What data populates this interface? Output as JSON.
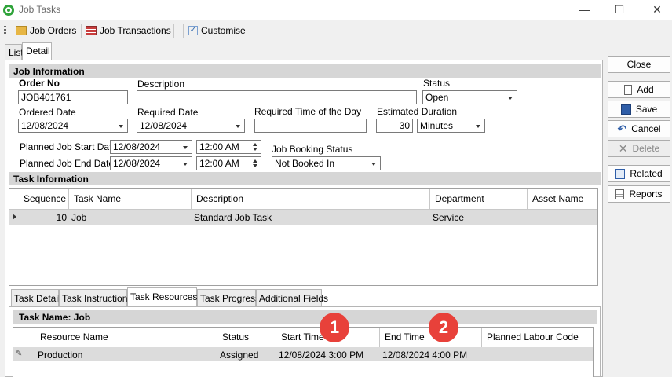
{
  "window": {
    "title": "Job Tasks",
    "minimize": "—",
    "maximize": "☐",
    "close": "✕"
  },
  "toolbar": {
    "job_orders": "Job Orders",
    "job_transactions": "Job Transactions",
    "customise": "Customise"
  },
  "tabs": {
    "list": "List",
    "detail": "Detail"
  },
  "job_info": {
    "header": "Job Information",
    "order_no_label": "Order No",
    "order_no": "JOB401761",
    "description_label": "Description",
    "description": "",
    "status_label": "Status",
    "status": "Open",
    "ordered_date_label": "Ordered Date",
    "ordered_date": "12/08/2024",
    "required_date_label": "Required Date",
    "required_date": "12/08/2024",
    "required_time_label": "Required Time of the Day",
    "required_time": "",
    "estimated_duration_label": "Estimated Duration",
    "estimated_duration": "30",
    "duration_unit": "Minutes",
    "start_label": "Planned Job Start Date",
    "start_date": "12/08/2024",
    "start_time": "12:00 AM",
    "end_label": "Planned Job End Date",
    "end_date": "12/08/2024",
    "end_time": "12:00 AM",
    "booking_status_label": "Job Booking Status",
    "booking_status": "Not Booked In"
  },
  "task_info": {
    "header": "Task Information",
    "columns": [
      "Sequence",
      "Task Name",
      "Description",
      "Department",
      "Asset Name"
    ],
    "rows": [
      {
        "sequence": "10",
        "task_name": "Job",
        "description": "Standard Job Task",
        "department": "Service",
        "asset_name": ""
      }
    ]
  },
  "lower_tabs": [
    "Task Detail",
    "Task Instructions",
    "Task Resources",
    "Task Progress",
    "Additional Fields"
  ],
  "task_resources": {
    "header": "Task Name: Job",
    "columns": [
      "Resource Name",
      "Status",
      "Start Time",
      "End Time",
      "Planned Labour Code"
    ],
    "rows": [
      {
        "resource_name": "Production",
        "status": "Assigned",
        "start_time": "12/08/2024 3:00 PM",
        "end_time": "12/08/2024 4:00 PM",
        "labour_code": ""
      }
    ]
  },
  "side_buttons": {
    "close": "Close",
    "add": "Add",
    "save": "Save",
    "cancel": "Cancel",
    "delete": "Delete",
    "related": "Related",
    "reports": "Reports"
  },
  "callouts": [
    "1",
    "2"
  ],
  "colors": {
    "accent_red": "#e8413a",
    "selected_row": "#dcdcdc",
    "section_header": "#d6d6d6"
  }
}
